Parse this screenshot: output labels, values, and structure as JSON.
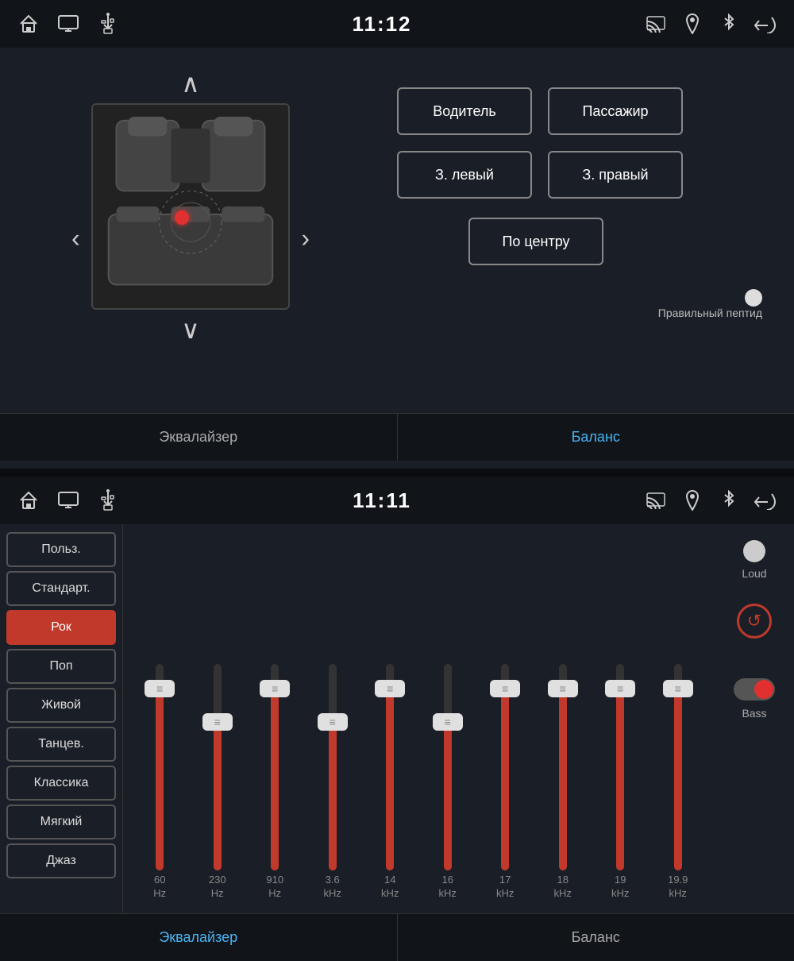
{
  "top": {
    "time": "11:12",
    "tab_equalizer": "Эквалайзер",
    "tab_balance": "Баланс",
    "active_tab": "balance",
    "seat_buttons": {
      "driver": "Водитель",
      "passenger": "Пассажир",
      "rear_left": "З. левый",
      "rear_right": "З. правый",
      "center": "По центру"
    },
    "indicator_label": "Правильный пептид",
    "arrow_up": "∧",
    "arrow_down": "∨",
    "arrow_left": "<",
    "arrow_right": ">"
  },
  "bottom": {
    "time": "11:11",
    "tab_equalizer": "Эквалайзер",
    "tab_balance": "Баланс",
    "active_tab": "equalizer",
    "presets": [
      {
        "id": "polz",
        "label": "Польз.",
        "active": false
      },
      {
        "id": "standar",
        "label": "Стандарт.",
        "active": false
      },
      {
        "id": "rok",
        "label": "Рок",
        "active": true
      },
      {
        "id": "pop",
        "label": "Поп",
        "active": false
      },
      {
        "id": "zhivoy",
        "label": "Живой",
        "active": false
      },
      {
        "id": "tancev",
        "label": "Танцев.",
        "active": false
      },
      {
        "id": "klassika",
        "label": "Классика",
        "active": false
      },
      {
        "id": "myagkiy",
        "label": "Мягкий",
        "active": false
      },
      {
        "id": "dzhaz",
        "label": "Джаз",
        "active": false
      }
    ],
    "eq_bands": [
      {
        "freq": "60",
        "unit": "Hz",
        "fill_pct": 88,
        "thumb_pct": 88
      },
      {
        "freq": "230",
        "unit": "Hz",
        "fill_pct": 72,
        "thumb_pct": 72
      },
      {
        "freq": "910",
        "unit": "Hz",
        "fill_pct": 88,
        "thumb_pct": 88
      },
      {
        "freq": "3.6",
        "unit": "kHz",
        "fill_pct": 72,
        "thumb_pct": 72
      },
      {
        "freq": "14",
        "unit": "kHz",
        "fill_pct": 88,
        "thumb_pct": 88
      },
      {
        "freq": "16",
        "unit": "kHz",
        "fill_pct": 72,
        "thumb_pct": 72
      },
      {
        "freq": "17",
        "unit": "kHz",
        "fill_pct": 88,
        "thumb_pct": 88
      },
      {
        "freq": "18",
        "unit": "kHz",
        "fill_pct": 88,
        "thumb_pct": 88
      },
      {
        "freq": "19",
        "unit": "kHz",
        "fill_pct": 88,
        "thumb_pct": 88
      },
      {
        "freq": "19.9",
        "unit": "kHz",
        "fill_pct": 88,
        "thumb_pct": 88
      }
    ],
    "loud_label": "Loud",
    "bass_label": "Bass",
    "reset_icon": "↺"
  }
}
